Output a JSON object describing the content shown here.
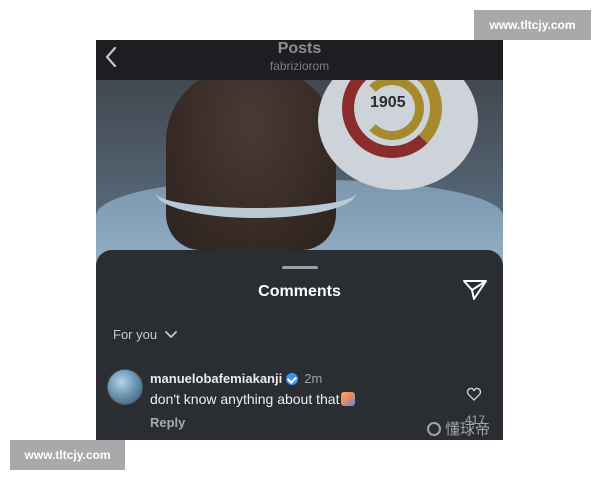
{
  "watermarks": {
    "top_right": "www.tltcjy.com",
    "bottom_left": "www.tltcjy.com",
    "corner_logo_text": "懂球帝"
  },
  "header": {
    "title": "Posts",
    "subtitle": "fabriziorom",
    "back_icon": "chevron-left-icon"
  },
  "post_image": {
    "badge_year": "1905"
  },
  "comments_sheet": {
    "title": "Comments",
    "share_icon": "paper-plane-icon",
    "filter_label": "For you",
    "filter_icon": "chevron-down-icon",
    "comments": [
      {
        "username": "manuelobafemiakanji",
        "verified": true,
        "time": "2m",
        "text": "don't know anything about that",
        "emoji": "person-shrugging-emoji",
        "reply_label": "Reply",
        "like_icon": "heart-outline-icon",
        "likes": "417"
      }
    ]
  },
  "colors": {
    "sheet_bg": "#2a2d31",
    "topbar_bg": "#1c1e21",
    "text_primary": "#ffffff",
    "text_secondary": "#a7abb0",
    "verified_blue": "#3b93f2",
    "badge_bg": "#a9a9a9"
  }
}
